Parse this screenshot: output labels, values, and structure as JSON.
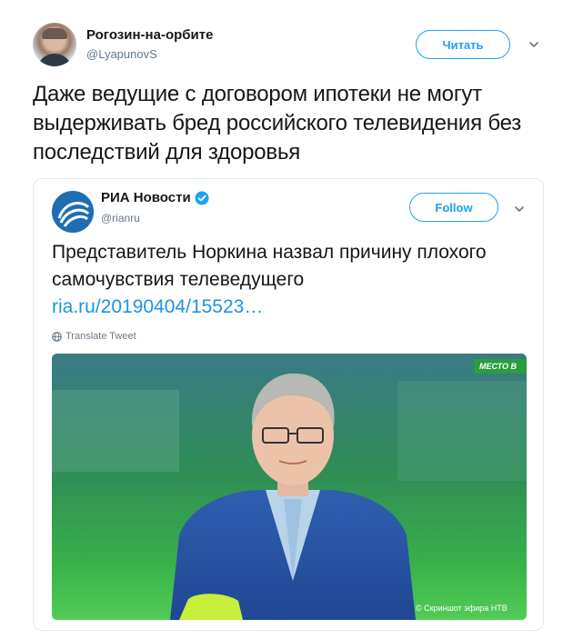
{
  "author": {
    "name": "Рогозин-на-орбите",
    "handle": "@LyapunovS"
  },
  "follow_label": "Читать",
  "tweet_text": "Даже ведущие с договором ипотеки не могут выдерживать бред российского телевидения без последствий для здоровья",
  "quoted": {
    "name": "РИА Новости",
    "handle": "@rianru",
    "follow_label": "Follow",
    "text": "Представитель Норкина назвал причину плохого самочувствия телеведущего",
    "link_text": "ria.ru/20190404/15523…",
    "translate_label": "Translate Tweet",
    "media": {
      "channel_badge": "МЕСТО В",
      "credit": "© Скриншот эфира НТВ"
    }
  },
  "colors": {
    "accent": "#1da1f2",
    "link": "#1b95e0",
    "text": "#14171a",
    "secondary": "#657786",
    "border": "#e1e8ed"
  },
  "icons": [
    "chevron-down-icon",
    "verified-badge-icon",
    "globe-icon"
  ]
}
